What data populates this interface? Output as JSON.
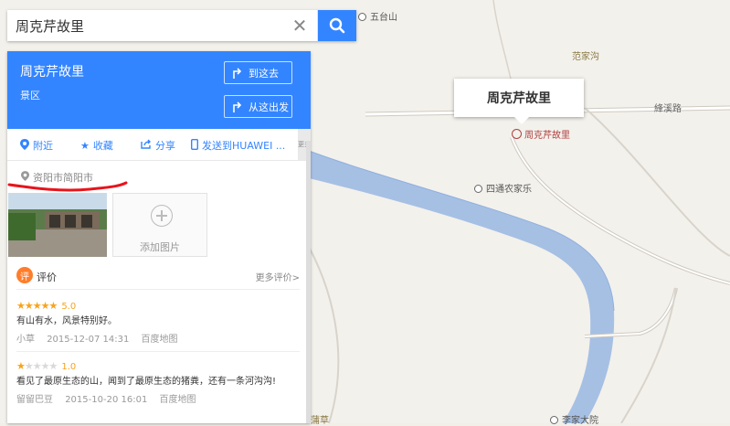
{
  "search": {
    "query": "周克芹故里"
  },
  "map": {
    "pois": [
      "五台山",
      "范家沟",
      "四通农家乐",
      "李家大院",
      "蒲草"
    ],
    "roads": [
      "綘溪路"
    ],
    "callout_title": "周克芹故里",
    "marker_label": "周克芹故里"
  },
  "panel": {
    "title": "周克芹故里",
    "category": "景区",
    "goto_label": "到这去",
    "from_label": "从这出发",
    "actions": [
      "附近",
      "收藏",
      "分享",
      "发送到HUAWEI ..."
    ],
    "more_label": "更多",
    "address": "资阳市简阳市",
    "add_photo_label": "添加图片",
    "reviews_badge": "评",
    "reviews_title": "评价",
    "reviews_more": "更多评价>",
    "reviews": [
      {
        "rating": 5,
        "score": "5.0",
        "text": "有山有水，风景特别好。",
        "user": "小草",
        "date": "2015-12-07 14:31",
        "source": "百度地图"
      },
      {
        "rating": 1,
        "score": "1.0",
        "text": "看见了最原生态的山，闻到了最原生态的猪粪，还有一条河沟沟!",
        "user": "留留巴豆",
        "date": "2015-10-20 16:01",
        "source": "百度地图"
      }
    ]
  },
  "colors": {
    "accent": "#3385ff",
    "river": "#a6c0e4",
    "star": "#f7a31c",
    "annotation": "#e8141b"
  }
}
